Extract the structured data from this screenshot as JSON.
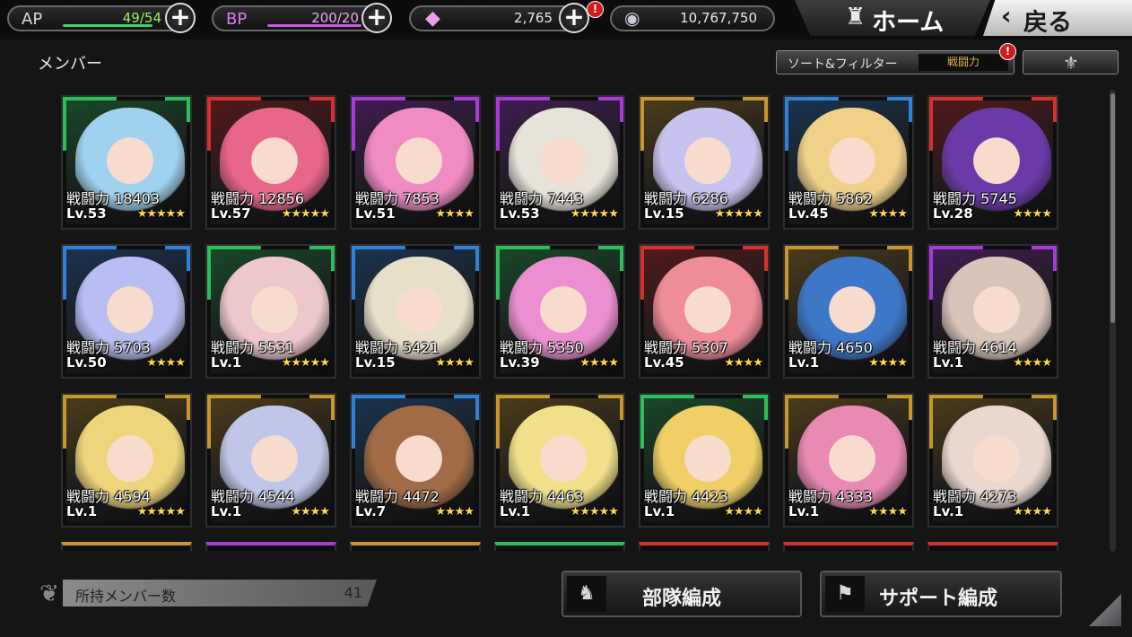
{
  "header": {
    "ap": {
      "label": "AP",
      "value": "49/54",
      "fill": 0.907
    },
    "bp": {
      "label": "BP",
      "value": "200/20",
      "fill": 1.0
    },
    "gems": {
      "value": "2,765",
      "badge": "!"
    },
    "coins": {
      "value": "10,767,750"
    },
    "home_label": "ホーム",
    "back_label": "戻る"
  },
  "page_title": "メンバー",
  "sort": {
    "label": "ソート&フィルター",
    "value": "戦闘力",
    "badge": "!"
  },
  "power_label": "戦闘力",
  "frame_colors": {
    "green": "#2bbf5a",
    "red": "#d83030",
    "purple": "#a83ad8",
    "gold": "#c8962d",
    "blue": "#2f82d8"
  },
  "members": [
    {
      "power": "18403",
      "level": "Lv.53",
      "stars": "★★★★★",
      "frame": "green",
      "hair": "#9fd2ef"
    },
    {
      "power": "12856",
      "level": "Lv.57",
      "stars": "★★★★★",
      "frame": "red",
      "hair": "#e8668a"
    },
    {
      "power": "7853",
      "level": "Lv.51",
      "stars": "★★★★",
      "frame": "purple",
      "hair": "#f08bc3"
    },
    {
      "power": "7443",
      "level": "Lv.53",
      "stars": "★★★★★",
      "frame": "purple",
      "hair": "#e7e3d8"
    },
    {
      "power": "6286",
      "level": "Lv.15",
      "stars": "★★★★★",
      "frame": "gold",
      "hair": "#c7c2ef"
    },
    {
      "power": "5862",
      "level": "Lv.45",
      "stars": "★★★★",
      "frame": "blue",
      "hair": "#f1d089"
    },
    {
      "power": "5745",
      "level": "Lv.28",
      "stars": "★★★★",
      "frame": "red",
      "hair": "#6a3aa8"
    },
    {
      "power": "5703",
      "level": "Lv.50",
      "stars": "★★★★",
      "frame": "blue",
      "hair": "#b8bdf2"
    },
    {
      "power": "5531",
      "level": "Lv.1",
      "stars": "★★★★★",
      "frame": "green",
      "hair": "#edc7cb"
    },
    {
      "power": "5421",
      "level": "Lv.15",
      "stars": "★★★★",
      "frame": "blue",
      "hair": "#e8dfc9"
    },
    {
      "power": "5350",
      "level": "Lv.39",
      "stars": "★★★★",
      "frame": "green",
      "hair": "#ec8fd2"
    },
    {
      "power": "5307",
      "level": "Lv.45",
      "stars": "★★★★",
      "frame": "red",
      "hair": "#ee8c98"
    },
    {
      "power": "4650",
      "level": "Lv.1",
      "stars": "★★★★",
      "frame": "gold",
      "hair": "#3d77c8"
    },
    {
      "power": "4614",
      "level": "Lv.1",
      "stars": "★★★★",
      "frame": "purple",
      "hair": "#d9c4ba"
    },
    {
      "power": "4594",
      "level": "Lv.1",
      "stars": "★★★★★",
      "frame": "gold",
      "hair": "#eed47a"
    },
    {
      "power": "4544",
      "level": "Lv.1",
      "stars": "★★★★",
      "frame": "gold",
      "hair": "#c0c6ea"
    },
    {
      "power": "4472",
      "level": "Lv.7",
      "stars": "★★★★",
      "frame": "blue",
      "hair": "#a06b45"
    },
    {
      "power": "4463",
      "level": "Lv.1",
      "stars": "★★★★★",
      "frame": "gold",
      "hair": "#f0e089"
    },
    {
      "power": "4423",
      "level": "Lv.1",
      "stars": "★★★★",
      "frame": "green",
      "hair": "#f0cf66"
    },
    {
      "power": "4333",
      "level": "Lv.1",
      "stars": "★★★★",
      "frame": "gold",
      "hair": "#e88ab4"
    },
    {
      "power": "4273",
      "level": "Lv.1",
      "stars": "★★★★",
      "frame": "gold",
      "hair": "#ead8cf"
    }
  ],
  "partial_row_frames": [
    "gold",
    "purple",
    "gold",
    "green",
    "red",
    "red",
    "red"
  ],
  "footer": {
    "member_count_label": "所持メンバー数",
    "member_count": "41",
    "squad_label": "部隊編成",
    "support_label": "サポート編成"
  },
  "icons": {
    "stamina": "lightning",
    "bp": "sword",
    "gem": "crystal-icon",
    "coin": "coin-icon",
    "home": "castle-icon",
    "back": "chevron-left-icon",
    "order": "fleur-icon"
  }
}
